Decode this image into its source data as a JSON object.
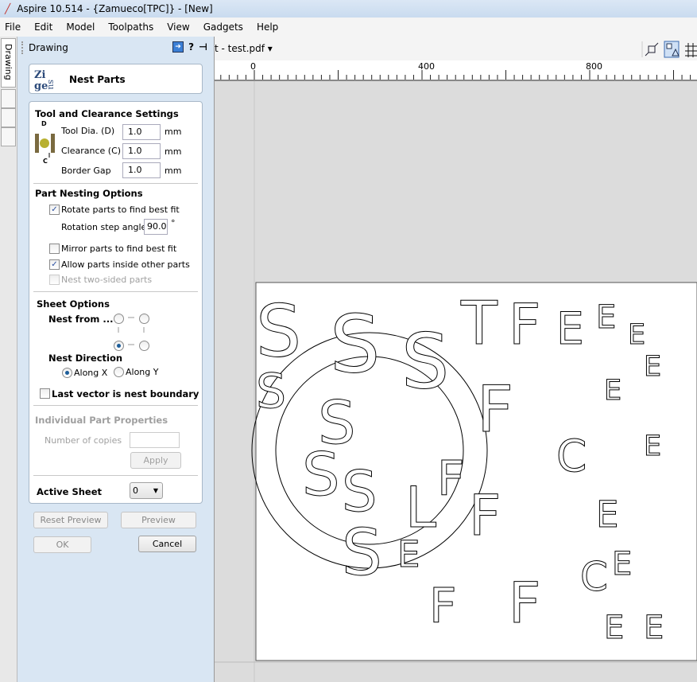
{
  "window": {
    "title": "Aspire 10.514 - {Zamueco[TPC]} - [New]"
  },
  "menu": [
    "File",
    "Edit",
    "Model",
    "Toolpaths",
    "View",
    "Gadgets",
    "Help"
  ],
  "side_tabs": {
    "drawing": "Drawing"
  },
  "panel": {
    "header": "Drawing",
    "help": "?",
    "title": "Nest Parts",
    "tool_section": "Tool and Clearance Settings",
    "tool_dia_label": "Tool Dia. (D)",
    "tool_dia": "1.0",
    "clearance_label": "Clearance (C)",
    "clearance": "1.0",
    "border_gap_label": "Border Gap",
    "border_gap": "1.0",
    "unit": "mm",
    "diagram_d": "D",
    "diagram_c": "C",
    "nesting_section": "Part Nesting Options",
    "rotate_label": "Rotate parts to find best fit",
    "rotate_checked": true,
    "rotation_step_label": "Rotation step angle",
    "rotation_step": "90.0",
    "degree": "°",
    "mirror_label": "Mirror parts to find best fit",
    "mirror_checked": false,
    "allow_inside_label": "Allow parts inside other parts",
    "allow_inside_checked": true,
    "two_sided_label": "Nest two-sided parts",
    "sheet_section": "Sheet Options",
    "nest_from_label": "Nest from ...",
    "nest_from_selected": "bottom-left",
    "direction_label": "Nest Direction",
    "along_x": "Along X",
    "along_y": "Along Y",
    "direction_selected": "x",
    "last_vector_label": "Last vector is nest boundary",
    "individual_section": "Individual Part Properties",
    "copies_label": "Number of copies",
    "copies": "",
    "apply": "Apply",
    "active_sheet_label": "Active Sheet",
    "active_sheet": "0",
    "reset_preview": "Reset Preview",
    "preview": "Preview",
    "ok": "OK",
    "cancel": "Cancel"
  },
  "document": {
    "tab": "t - test.pdf"
  },
  "ruler": {
    "labels": [
      "0",
      "400",
      "800"
    ]
  }
}
